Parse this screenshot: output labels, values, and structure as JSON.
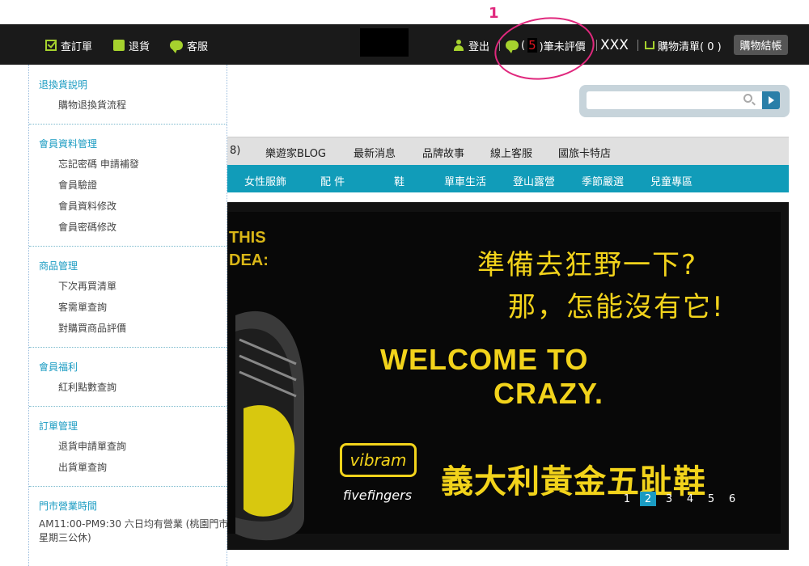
{
  "annotation": {
    "number": "1"
  },
  "topbar": {
    "orders": "查訂單",
    "returns": "退貨",
    "support": "客服",
    "logout": "登出",
    "unrated_prefix": "(",
    "unrated_count": "5",
    "unrated_suffix": ")筆未評價",
    "username": "XXX",
    "cart": "購物清單( 0 )",
    "checkout": "購物結帳"
  },
  "sidebar": {
    "sections": [
      {
        "title": "退換貨說明",
        "items": [
          "購物退換貨流程"
        ]
      },
      {
        "title": "會員資料管理",
        "items": [
          "忘記密碼 申請補發",
          "會員驗證",
          "會員資料修改",
          "會員密碼修改"
        ]
      },
      {
        "title": "商品管理",
        "items": [
          "下次再買清單",
          "客需單查詢",
          "對購買商品評價"
        ]
      },
      {
        "title": "會員福利",
        "items": [
          "紅利點數查詢"
        ]
      },
      {
        "title": "訂單管理",
        "items": [
          "退貨申請單查詢",
          "出貨單查詢"
        ]
      },
      {
        "title": "門市營業時間",
        "items": [
          "AM11:00-PM9:30 六日均有營業 (桃園門市",
          "星期三公休)"
        ]
      }
    ]
  },
  "search": {
    "placeholder": ""
  },
  "gray_nav": [
    "8)",
    "樂遊家BLOG",
    "最新消息",
    "品牌故事",
    "線上客服",
    "國旅卡特店"
  ],
  "teal_nav": [
    "女性服飾",
    "配 件",
    "鞋",
    "單車生活",
    "登山露營",
    "季節嚴選",
    "兒童專區"
  ],
  "banner": {
    "left_text_1": "THIS",
    "left_text_2": "DEA:",
    "cn_line1": "準備去狂野一下?",
    "cn_line2": "那，怎能沒有它!",
    "welcome_1": "WELCOME TO",
    "welcome_2": "CRAZY.",
    "brand": "vibram",
    "sub_brand": "fivefingers",
    "product": "義大利黃金五趾鞋",
    "pages": [
      "1",
      "2",
      "3",
      "4",
      "5",
      "6"
    ],
    "active_page": "2"
  },
  "colors": {
    "accent_green": "#a6d22e",
    "teal": "#119cb9",
    "link_blue": "#1a9bc2",
    "annotation": "#e0287d",
    "banner_yellow": "#f2d31b"
  }
}
